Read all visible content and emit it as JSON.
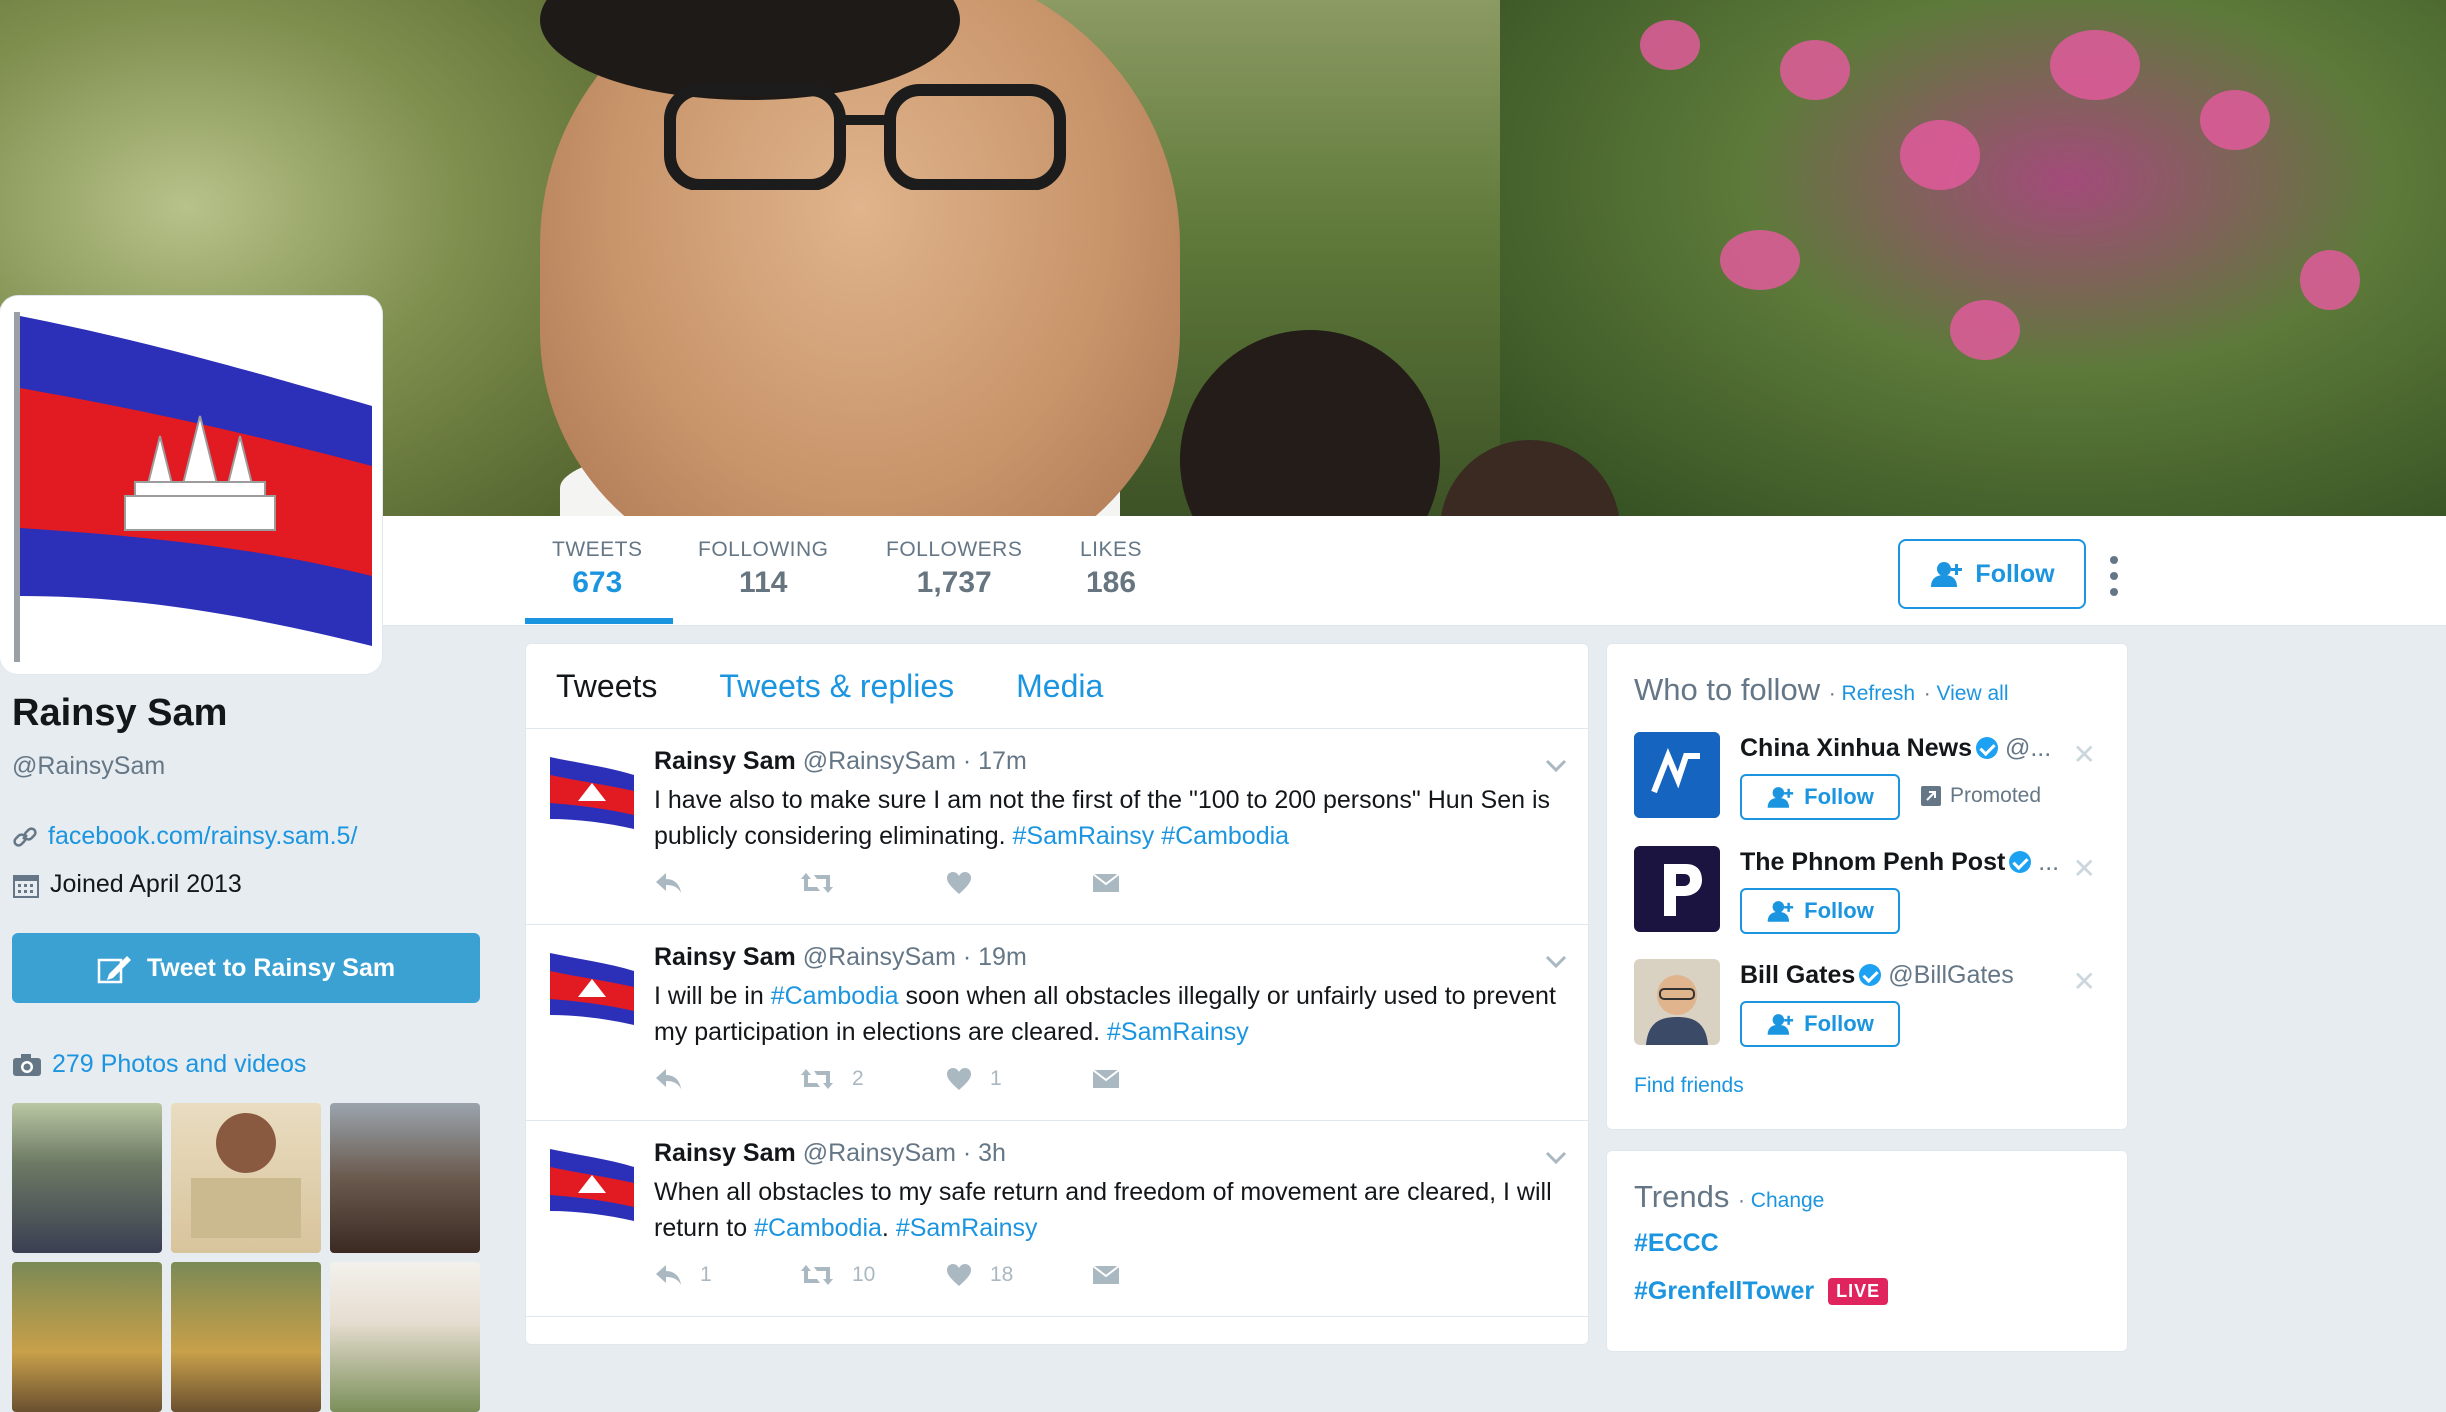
{
  "profile": {
    "name": "Rainsy Sam",
    "handle": "@RainsySam",
    "website": "facebook.com/rainsy.sam.5/",
    "joined": "Joined April 2013",
    "tweet_to_label": "Tweet to Rainsy Sam",
    "photos_label": "279 Photos and videos"
  },
  "stats": [
    {
      "label": "TWEETS",
      "value": "673"
    },
    {
      "label": "FOLLOWING",
      "value": "114"
    },
    {
      "label": "FOLLOWERS",
      "value": "1,737"
    },
    {
      "label": "LIKES",
      "value": "186"
    }
  ],
  "follow_label": "Follow",
  "timeline": {
    "tabs": [
      "Tweets",
      "Tweets & replies",
      "Media"
    ],
    "tweets": [
      {
        "name": "Rainsy Sam",
        "handle": "@RainsySam",
        "time": "17m",
        "text": "I have also to make sure I am not the first of the \"100 to 200  persons\" Hun Sen is publicly considering eliminating. ",
        "hashtags": "#SamRainsy #Cambodia",
        "retweets": "",
        "likes": ""
      },
      {
        "name": "Rainsy Sam",
        "handle": "@RainsySam",
        "time": "19m",
        "text_a": "I will be in ",
        "tag_a": "#Cambodia",
        "text_b": " soon when all obstacles illegally or unfairly used to prevent my participation in elections are cleared. ",
        "tag_b": "#SamRainsy",
        "retweets": "2",
        "likes": "1"
      },
      {
        "name": "Rainsy Sam",
        "handle": "@RainsySam",
        "time": "3h",
        "text_a": "When all obstacles to my safe return and freedom of movement are cleared, I will return to ",
        "tag_a": "#Cambodia",
        "text_b": ". ",
        "tag_b": "#SamRainsy",
        "replies": "1",
        "retweets": "10",
        "likes": "18"
      }
    ]
  },
  "who_to_follow": {
    "title": "Who to follow",
    "refresh": "Refresh",
    "view_all": "View all",
    "suggestions": [
      {
        "name": "China Xinhua News",
        "handle": "@...",
        "follow": "Follow",
        "promoted": "Promoted"
      },
      {
        "name": "The Phnom Penh Post",
        "handle": "...",
        "follow": "Follow"
      },
      {
        "name": "Bill Gates",
        "handle": "@BillGates",
        "follow": "Follow"
      }
    ],
    "find_friends": "Find friends"
  },
  "trends": {
    "title": "Trends",
    "change": "Change",
    "items": [
      "#ECCC",
      "#GrenfellTower"
    ],
    "live": "LIVE"
  },
  "colors": {
    "accent": "#1b95e0",
    "tweet_button": "#3ba1d3",
    "live": "#e0245e"
  }
}
